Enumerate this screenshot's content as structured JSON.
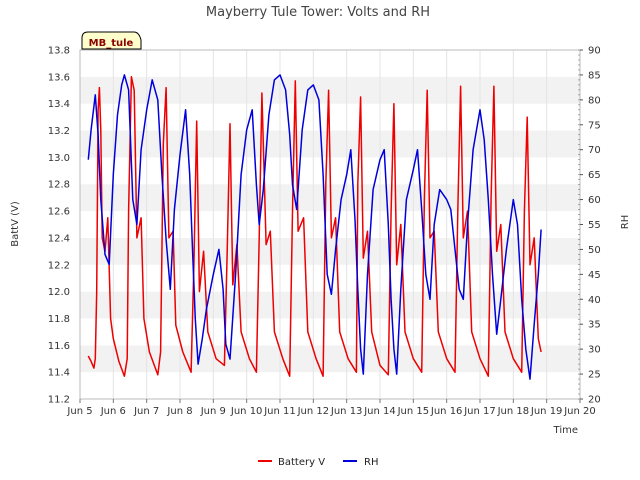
{
  "chart_data": {
    "type": "line",
    "title": "Mayberry Tule Tower: Volts and RH",
    "station_label": "MB_tule",
    "xlabel": "Time",
    "ylabel": "BattV (V)",
    "y2label": "RH",
    "x_tick_labels": [
      "Jun 5",
      "Jun 6",
      "Jun 7",
      "Jun 8",
      "Jun 9",
      "Jun 10",
      "Jun 11",
      "Jun 12",
      "Jun 13",
      "Jun 14",
      "Jun 15",
      "Jun 16",
      "Jun 17",
      "Jun 18",
      "Jun 19",
      "Jun 20"
    ],
    "xlim": [
      "Jun 5",
      "Jun 20"
    ],
    "ylim": [
      11.2,
      13.8
    ],
    "y_ticks": [
      "11.2",
      "11.4",
      "11.6",
      "11.8",
      "12.0",
      "12.2",
      "12.4",
      "12.6",
      "12.8",
      "13.0",
      "13.2",
      "13.4",
      "13.6",
      "13.8"
    ],
    "y2lim": [
      20,
      90
    ],
    "y2_ticks": [
      "20",
      "25",
      "30",
      "35",
      "40",
      "45",
      "50",
      "55",
      "60",
      "65",
      "70",
      "75",
      "80",
      "85",
      "90"
    ],
    "grid": "horizontal alternating bands",
    "legend_position": "bottom-center",
    "series": [
      {
        "name": "Battery V",
        "axis": "left",
        "color": "#ee0000",
        "points": [
          [
            "Jun 5 06:00",
            11.52
          ],
          [
            "Jun 5 08:00",
            11.48
          ],
          [
            "Jun 5 10:00",
            11.43
          ],
          [
            "Jun 5 11:00",
            11.5
          ],
          [
            "Jun 5 12:00",
            12.0
          ],
          [
            "Jun 5 13:00",
            13.35
          ],
          [
            "Jun 5 14:00",
            13.52
          ],
          [
            "Jun 5 15:00",
            13.2
          ],
          [
            "Jun 5 16:00",
            12.4
          ],
          [
            "Jun 5 18:00",
            12.3
          ],
          [
            "Jun 5 20:00",
            12.55
          ],
          [
            "Jun 5 22:00",
            11.8
          ],
          [
            "Jun 6 00:00",
            11.65
          ],
          [
            "Jun 6 04:00",
            11.48
          ],
          [
            "Jun 6 08:00",
            11.37
          ],
          [
            "Jun 6 10:00",
            11.5
          ],
          [
            "Jun 6 11:00",
            12.6
          ],
          [
            "Jun 6 13:00",
            13.6
          ],
          [
            "Jun 6 15:00",
            13.5
          ],
          [
            "Jun 6 17:00",
            12.4
          ],
          [
            "Jun 6 20:00",
            12.55
          ],
          [
            "Jun 6 22:00",
            11.8
          ],
          [
            "Jun 7 02:00",
            11.55
          ],
          [
            "Jun 7 08:00",
            11.38
          ],
          [
            "Jun 7 10:00",
            11.55
          ],
          [
            "Jun 7 12:00",
            13.1
          ],
          [
            "Jun 7 14:00",
            13.52
          ],
          [
            "Jun 7 16:00",
            12.4
          ],
          [
            "Jun 7 19:00",
            12.45
          ],
          [
            "Jun 7 21:00",
            11.75
          ],
          [
            "Jun 8 02:00",
            11.55
          ],
          [
            "Jun 8 08:00",
            11.4
          ],
          [
            "Jun 8 10:00",
            12.2
          ],
          [
            "Jun 8 12:00",
            13.27
          ],
          [
            "Jun 8 14:00",
            12.0
          ],
          [
            "Jun 8 17:00",
            12.3
          ],
          [
            "Jun 8 20:00",
            11.7
          ],
          [
            "Jun 9 02:00",
            11.5
          ],
          [
            "Jun 9 08:00",
            11.45
          ],
          [
            "Jun 9 10:00",
            12.3
          ],
          [
            "Jun 9 12:00",
            13.25
          ],
          [
            "Jun 9 14:00",
            12.05
          ],
          [
            "Jun 9 17:00",
            12.35
          ],
          [
            "Jun 9 20:00",
            11.7
          ],
          [
            "Jun 10 02:00",
            11.5
          ],
          [
            "Jun 10 07:00",
            11.4
          ],
          [
            "Jun 10 09:00",
            12.4
          ],
          [
            "Jun 10 11:00",
            13.48
          ],
          [
            "Jun 10 14:00",
            12.35
          ],
          [
            "Jun 10 17:00",
            12.45
          ],
          [
            "Jun 10 20:00",
            11.7
          ],
          [
            "Jun 11 02:00",
            11.5
          ],
          [
            "Jun 11 07:00",
            11.37
          ],
          [
            "Jun 11 09:00",
            12.6
          ],
          [
            "Jun 11 11:00",
            13.57
          ],
          [
            "Jun 11 13:00",
            12.45
          ],
          [
            "Jun 11 17:00",
            12.55
          ],
          [
            "Jun 11 20:00",
            11.7
          ],
          [
            "Jun 12 02:00",
            11.5
          ],
          [
            "Jun 12 07:00",
            11.37
          ],
          [
            "Jun 12 09:00",
            12.8
          ],
          [
            "Jun 12 11:00",
            13.5
          ],
          [
            "Jun 12 13:00",
            12.4
          ],
          [
            "Jun 12 16:00",
            12.55
          ],
          [
            "Jun 12 19:00",
            11.7
          ],
          [
            "Jun 13 01:00",
            11.5
          ],
          [
            "Jun 13 07:00",
            11.4
          ],
          [
            "Jun 13 08:00",
            12.8
          ],
          [
            "Jun 13 10:00",
            13.45
          ],
          [
            "Jun 13 12:00",
            12.25
          ],
          [
            "Jun 13 15:00",
            12.45
          ],
          [
            "Jun 13 18:00",
            11.7
          ],
          [
            "Jun 14 00:00",
            11.45
          ],
          [
            "Jun 14 06:00",
            11.38
          ],
          [
            "Jun 14 08:00",
            12.6
          ],
          [
            "Jun 14 10:00",
            13.4
          ],
          [
            "Jun 14 12:00",
            12.2
          ],
          [
            "Jun 14 15:00",
            12.5
          ],
          [
            "Jun 14 18:00",
            11.7
          ],
          [
            "Jun 15 00:00",
            11.5
          ],
          [
            "Jun 15 06:00",
            11.4
          ],
          [
            "Jun 15 08:00",
            12.7
          ],
          [
            "Jun 15 10:00",
            13.5
          ],
          [
            "Jun 15 12:00",
            12.4
          ],
          [
            "Jun 15 15:00",
            12.45
          ],
          [
            "Jun 15 18:00",
            11.7
          ],
          [
            "Jun 16 00:00",
            11.5
          ],
          [
            "Jun 16 06:00",
            11.4
          ],
          [
            "Jun 16 08:00",
            12.6
          ],
          [
            "Jun 16 10:00",
            13.53
          ],
          [
            "Jun 16 12:00",
            12.4
          ],
          [
            "Jun 16 15:00",
            12.6
          ],
          [
            "Jun 16 18:00",
            11.7
          ],
          [
            "Jun 17 00:00",
            11.5
          ],
          [
            "Jun 17 06:00",
            11.37
          ],
          [
            "Jun 17 08:00",
            12.7
          ],
          [
            "Jun 17 10:00",
            13.53
          ],
          [
            "Jun 17 12:00",
            12.3
          ],
          [
            "Jun 17 15:00",
            12.5
          ],
          [
            "Jun 17 18:00",
            11.7
          ],
          [
            "Jun 18 00:00",
            11.5
          ],
          [
            "Jun 18 06:00",
            11.4
          ],
          [
            "Jun 18 08:00",
            12.6
          ],
          [
            "Jun 18 10:00",
            13.3
          ],
          [
            "Jun 18 12:00",
            12.2
          ],
          [
            "Jun 18 15:00",
            12.4
          ],
          [
            "Jun 18 18:00",
            11.65
          ],
          [
            "Jun 18 20:00",
            11.55
          ]
        ]
      },
      {
        "name": "RH",
        "axis": "right",
        "color": "#0000dd",
        "points": [
          [
            "Jun 5 06:00",
            68
          ],
          [
            "Jun 5 08:00",
            74
          ],
          [
            "Jun 5 11:00",
            81
          ],
          [
            "Jun 5 13:00",
            73
          ],
          [
            "Jun 5 15:00",
            60
          ],
          [
            "Jun 5 18:00",
            49
          ],
          [
            "Jun 5 21:00",
            47
          ],
          [
            "Jun 6 00:00",
            65
          ],
          [
            "Jun 6 03:00",
            77
          ],
          [
            "Jun 6 06:00",
            83
          ],
          [
            "Jun 6 08:00",
            85
          ],
          [
            "Jun 6 11:00",
            82
          ],
          [
            "Jun 6 14:00",
            60
          ],
          [
            "Jun 6 17:00",
            55
          ],
          [
            "Jun 6 20:00",
            70
          ],
          [
            "Jun 7 00:00",
            78
          ],
          [
            "Jun 7 04:00",
            84
          ],
          [
            "Jun 7 08:00",
            80
          ],
          [
            "Jun 7 11:00",
            65
          ],
          [
            "Jun 7 14:00",
            52
          ],
          [
            "Jun 7 17:00",
            42
          ],
          [
            "Jun 7 20:00",
            58
          ],
          [
            "Jun 8 00:00",
            69
          ],
          [
            "Jun 8 04:00",
            78
          ],
          [
            "Jun 8 07:00",
            65
          ],
          [
            "Jun 8 09:00",
            50
          ],
          [
            "Jun 8 11:00",
            36
          ],
          [
            "Jun 8 13:00",
            27
          ],
          [
            "Jun 8 16:00",
            32
          ],
          [
            "Jun 8 19:00",
            38
          ],
          [
            "Jun 9 00:00",
            45
          ],
          [
            "Jun 9 04:00",
            50
          ],
          [
            "Jun 9 07:00",
            42
          ],
          [
            "Jun 9 09:00",
            31
          ],
          [
            "Jun 9 12:00",
            28
          ],
          [
            "Jun 9 16:00",
            45
          ],
          [
            "Jun 9 20:00",
            65
          ],
          [
            "Jun 10 00:00",
            74
          ],
          [
            "Jun 10 04:00",
            78
          ],
          [
            "Jun 10 07:00",
            63
          ],
          [
            "Jun 10 09:00",
            55
          ],
          [
            "Jun 10 12:00",
            62
          ],
          [
            "Jun 10 16:00",
            77
          ],
          [
            "Jun 10 20:00",
            84
          ],
          [
            "Jun 11 00:00",
            85
          ],
          [
            "Jun 11 04:00",
            82
          ],
          [
            "Jun 11 07:00",
            73
          ],
          [
            "Jun 11 09:00",
            63
          ],
          [
            "Jun 11 12:00",
            58
          ],
          [
            "Jun 11 16:00",
            74
          ],
          [
            "Jun 11 20:00",
            82
          ],
          [
            "Jun 12 00:00",
            83
          ],
          [
            "Jun 12 04:00",
            80
          ],
          [
            "Jun 12 07:00",
            65
          ],
          [
            "Jun 12 10:00",
            45
          ],
          [
            "Jun 12 13:00",
            41
          ],
          [
            "Jun 12 16:00",
            50
          ],
          [
            "Jun 12 20:00",
            60
          ],
          [
            "Jun 13 00:00",
            65
          ],
          [
            "Jun 13 03:00",
            70
          ],
          [
            "Jun 13 06:00",
            56
          ],
          [
            "Jun 13 08:00",
            42
          ],
          [
            "Jun 13 10:00",
            30
          ],
          [
            "Jun 13 12:00",
            25
          ],
          [
            "Jun 13 15:00",
            45
          ],
          [
            "Jun 13 19:00",
            62
          ],
          [
            "Jun 14 00:00",
            68
          ],
          [
            "Jun 14 03:00",
            70
          ],
          [
            "Jun 14 06:00",
            55
          ],
          [
            "Jun 14 08:00",
            40
          ],
          [
            "Jun 14 10:00",
            30
          ],
          [
            "Jun 14 12:00",
            25
          ],
          [
            "Jun 14 15:00",
            42
          ],
          [
            "Jun 14 19:00",
            60
          ],
          [
            "Jun 15 00:00",
            66
          ],
          [
            "Jun 15 03:00",
            70
          ],
          [
            "Jun 15 06:00",
            58
          ],
          [
            "Jun 15 09:00",
            45
          ],
          [
            "Jun 15 12:00",
            40
          ],
          [
            "Jun 15 15:00",
            55
          ],
          [
            "Jun 15 19:00",
            62
          ],
          [
            "Jun 16 00:00",
            60
          ],
          [
            "Jun 16 03:00",
            58
          ],
          [
            "Jun 16 06:00",
            50
          ],
          [
            "Jun 16 09:00",
            42
          ],
          [
            "Jun 16 12:00",
            40
          ],
          [
            "Jun 16 15:00",
            55
          ],
          [
            "Jun 16 19:00",
            70
          ],
          [
            "Jun 17 00:00",
            78
          ],
          [
            "Jun 17 03:00",
            72
          ],
          [
            "Jun 17 06:00",
            60
          ],
          [
            "Jun 17 09:00",
            45
          ],
          [
            "Jun 17 12:00",
            33
          ],
          [
            "Jun 17 15:00",
            40
          ],
          [
            "Jun 17 19:00",
            50
          ],
          [
            "Jun 18 00:00",
            60
          ],
          [
            "Jun 18 03:00",
            55
          ],
          [
            "Jun 18 06:00",
            40
          ],
          [
            "Jun 18 09:00",
            30
          ],
          [
            "Jun 18 12:00",
            24
          ],
          [
            "Jun 18 15:00",
            35
          ],
          [
            "Jun 18 18:00",
            45
          ],
          [
            "Jun 18 20:00",
            54
          ]
        ]
      }
    ]
  }
}
